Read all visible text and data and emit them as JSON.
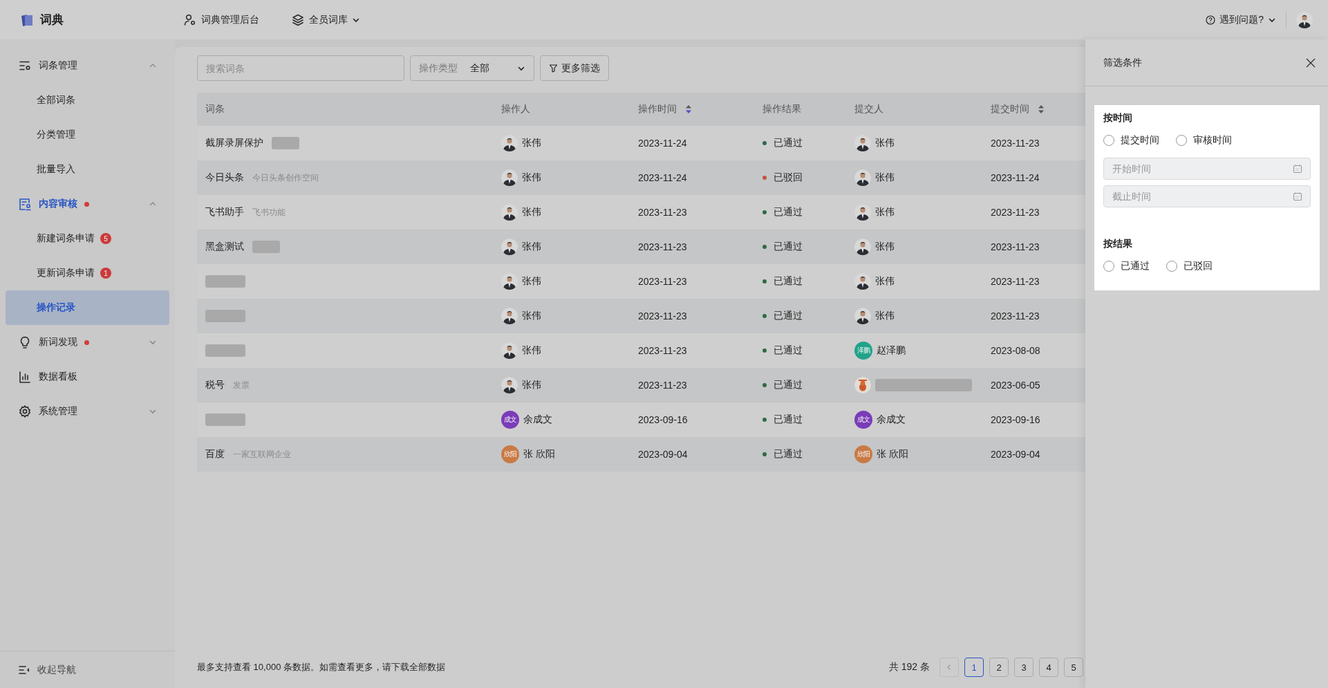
{
  "topbar": {
    "logo_text": "词典",
    "nav": [
      {
        "label": "词典管理后台",
        "dropdown": false
      },
      {
        "label": "全员词库",
        "dropdown": true
      }
    ],
    "help": "遇到问题?"
  },
  "sidebar": {
    "items": [
      {
        "label": "词条管理",
        "active": false,
        "dot": false,
        "expanded": true,
        "children": [
          {
            "label": "全部词条",
            "selected": false
          },
          {
            "label": "分类管理",
            "selected": false
          },
          {
            "label": "批量导入",
            "selected": false
          }
        ]
      },
      {
        "label": "内容审核",
        "active": true,
        "dot": true,
        "expanded": true,
        "children": [
          {
            "label": "新建词条申请",
            "badge": "5",
            "selected": false
          },
          {
            "label": "更新词条申请",
            "badge": "1",
            "selected": false
          },
          {
            "label": "操作记录",
            "selected": true
          }
        ]
      },
      {
        "label": "新词发现",
        "active": false,
        "dot": true,
        "expanded": false
      },
      {
        "label": "数据看板",
        "active": false,
        "dot": false
      },
      {
        "label": "系统管理",
        "active": false,
        "dot": false,
        "expanded": false
      }
    ],
    "collapse": "收起导航"
  },
  "toolbar": {
    "search_placeholder": "搜索词条",
    "type_select": {
      "label": "操作类型",
      "value": "全部"
    },
    "more_filters": "更多筛选"
  },
  "table": {
    "columns": [
      {
        "label": "词条",
        "sortable": false
      },
      {
        "label": "操作人",
        "sortable": false
      },
      {
        "label": "操作时间",
        "sortable": true,
        "sorted": true
      },
      {
        "label": "操作结果",
        "sortable": false
      },
      {
        "label": "提交人",
        "sortable": false
      },
      {
        "label": "提交时间",
        "sortable": true,
        "sorted": false
      }
    ],
    "rows": [
      {
        "term": "截屏录屏保护",
        "term_blurred": false,
        "note_blurred": true,
        "operator": {
          "name": "张伟",
          "kind": "photo"
        },
        "op_time": "2023-11-24",
        "result": {
          "label": "已通过",
          "color": "#2e6a4a"
        },
        "submitter": {
          "name": "张伟",
          "kind": "photo"
        },
        "submit_time": "2023-11-23"
      },
      {
        "term": "今日头条",
        "term_blurred": false,
        "note": "今日头条创作空间",
        "note_blurred": false,
        "operator": {
          "name": "张伟",
          "kind": "photo"
        },
        "op_time": "2023-11-24",
        "result": {
          "label": "已驳回",
          "color": "#c0553c"
        },
        "submitter": {
          "name": "张伟",
          "kind": "photo"
        },
        "submit_time": "2023-11-24"
      },
      {
        "term": "飞书助手",
        "term_blurred": false,
        "note": "飞书功能",
        "note_blurred": false,
        "operator": {
          "name": "张伟",
          "kind": "photo"
        },
        "op_time": "2023-11-23",
        "result": {
          "label": "已通过",
          "color": "#2e6a4a"
        },
        "submitter": {
          "name": "张伟",
          "kind": "photo"
        },
        "submit_time": "2023-11-23"
      },
      {
        "term": "黑盒测试",
        "term_blurred": false,
        "note_blurred": true,
        "operator": {
          "name": "张伟",
          "kind": "photo"
        },
        "op_time": "2023-11-23",
        "result": {
          "label": "已通过",
          "color": "#2e6a4a"
        },
        "submitter": {
          "name": "张伟",
          "kind": "photo"
        },
        "submit_time": "2023-11-23"
      },
      {
        "term_blurred": true,
        "operator": {
          "name": "张伟",
          "kind": "photo"
        },
        "op_time": "2023-11-23",
        "result": {
          "label": "已通过",
          "color": "#2e6a4a"
        },
        "submitter": {
          "name": "张伟",
          "kind": "photo"
        },
        "submit_time": "2023-11-23"
      },
      {
        "term_blurred": true,
        "operator": {
          "name": "张伟",
          "kind": "photo"
        },
        "op_time": "2023-11-23",
        "result": {
          "label": "已通过",
          "color": "#2e6a4a"
        },
        "submitter": {
          "name": "张伟",
          "kind": "photo"
        },
        "submit_time": "2023-11-23"
      },
      {
        "term_blurred": true,
        "operator": {
          "name": "张伟",
          "kind": "photo"
        },
        "op_time": "2023-11-23",
        "result": {
          "label": "已通过",
          "color": "#2e6a4a"
        },
        "submitter": {
          "name": "赵泽鹏",
          "kind": "initials",
          "initials": "泽鹏",
          "color": "#21a38a"
        },
        "submit_time": "2023-08-08"
      },
      {
        "term": "税号",
        "term_blurred": false,
        "note": "发票",
        "note_blurred": false,
        "operator": {
          "name": "张伟",
          "kind": "photo"
        },
        "op_time": "2023-11-23",
        "result": {
          "label": "已通过",
          "color": "#2e6a4a"
        },
        "submitter": {
          "name_blurred": true,
          "kind": "cartoon"
        },
        "submit_time": "2023-06-05"
      },
      {
        "term_blurred": true,
        "operator": {
          "name": "余成文",
          "kind": "initials",
          "initials": "成文",
          "color": "#7a3cb8"
        },
        "op_time": "2023-09-16",
        "result": {
          "label": "已通过",
          "color": "#2e6a4a"
        },
        "submitter": {
          "name": "余成文",
          "kind": "initials",
          "initials": "成文",
          "color": "#7a3cb8"
        },
        "submit_time": "2023-09-16"
      },
      {
        "term": "百度",
        "term_blurred": false,
        "note": "一家互联网企业",
        "note_blurred": false,
        "operator": {
          "name": "张 欣阳",
          "kind": "initials",
          "initials": "欣阳",
          "color": "#c97a45"
        },
        "op_time": "2023-09-04",
        "result": {
          "label": "已通过",
          "color": "#2e6a4a"
        },
        "submitter": {
          "name": "张 欣阳",
          "kind": "initials",
          "initials": "欣阳",
          "color": "#c97a45"
        },
        "submit_time": "2023-09-04"
      }
    ]
  },
  "footer": {
    "note": "最多支持查看 10,000 条数据。如需查看更多，请下载全部数据",
    "total": "共 192 条",
    "prev_disabled": true,
    "pages": [
      {
        "label": "1",
        "selected": true
      },
      {
        "label": "2",
        "selected": false
      },
      {
        "label": "3",
        "selected": false
      },
      {
        "label": "4",
        "selected": false
      },
      {
        "label": "5",
        "selected": false
      }
    ]
  },
  "drawer": {
    "title": "筛选条件",
    "sections": [
      {
        "title": "按时间",
        "options": [
          {
            "label": "提交时间",
            "checked": false
          },
          {
            "label": "审核时间",
            "checked": false
          }
        ],
        "fields": [
          {
            "placeholder": "开始时间"
          },
          {
            "placeholder": "截止时间"
          }
        ]
      },
      {
        "title": "按结果",
        "options": [
          {
            "label": "已通过",
            "checked": false
          },
          {
            "label": "已驳回",
            "checked": false
          }
        ]
      }
    ]
  }
}
